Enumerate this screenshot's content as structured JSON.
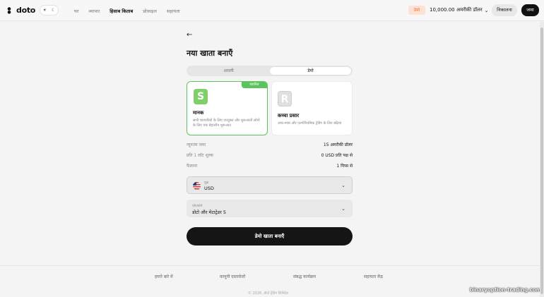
{
  "header": {
    "logo_text": "doto",
    "theme_icons": [
      "sun-icon",
      "moon-icon"
    ],
    "nav": [
      "घर",
      "व्यापार",
      "हिसाब किताब",
      "प्रोफ़ाइल",
      "सहायता"
    ],
    "active_nav": "हिसाब किताब",
    "demo_badge": "डेमो",
    "balance": "10,000.00 अमरीकी डॉलर",
    "withdraw_label": "निकालना",
    "deposit_label": "जमा"
  },
  "main": {
    "title": "नया खाता बनाएँ",
    "tabs": {
      "real": "असली",
      "demo": "डेमो"
    },
    "active_tab": "demo",
    "cards": {
      "standard": {
        "ribbon": "चयनित",
        "icon_letter": "S",
        "name": "मानक",
        "description": "सभी व्यापारियों के लिए उपयुक्त और शुरूआती लोगों के लिए एक बेहतरीन शुरूआत"
      },
      "raw": {
        "icon_letter": "R",
        "name": "कच्चा प्रसार",
        "description": "उच्च-मात्रा और एल्गोरिथमिक ट्रेडिंग के लिए बढ़िया"
      }
    },
    "stats": [
      {
        "label": "न्यूनतम जमा",
        "value": "15 अमरीकी डॉलर"
      },
      {
        "label": "प्रति 1 लॉट शुल्क",
        "value": "0 USD प्रति पक्ष से"
      },
      {
        "label": "फैलाना",
        "value": "1 पिप्स से"
      }
    ],
    "currency": {
      "caption": "मुद्रा",
      "value": "USD"
    },
    "platform": {
      "caption": "प्लेटफॉर्म",
      "value": "डोटो और मेटाट्रेडर 5"
    },
    "create_button": "डेमो खाता बनाएँ"
  },
  "footer": {
    "links": [
      "हमारे बारे में",
      "कानूनी दस्तावेजों",
      "संबद्ध कार्यक्रम",
      "सहायता केंद्र"
    ],
    "copyright": "© 2026, डोटो ट्रेडिंग लिमिटेड"
  },
  "watermark": "binaryoption-trading.com",
  "colors": {
    "accent_green": "#5cc45c",
    "dark": "#151515",
    "demo_badge_bg": "#fde2d4",
    "demo_badge_text": "#e8743f"
  }
}
